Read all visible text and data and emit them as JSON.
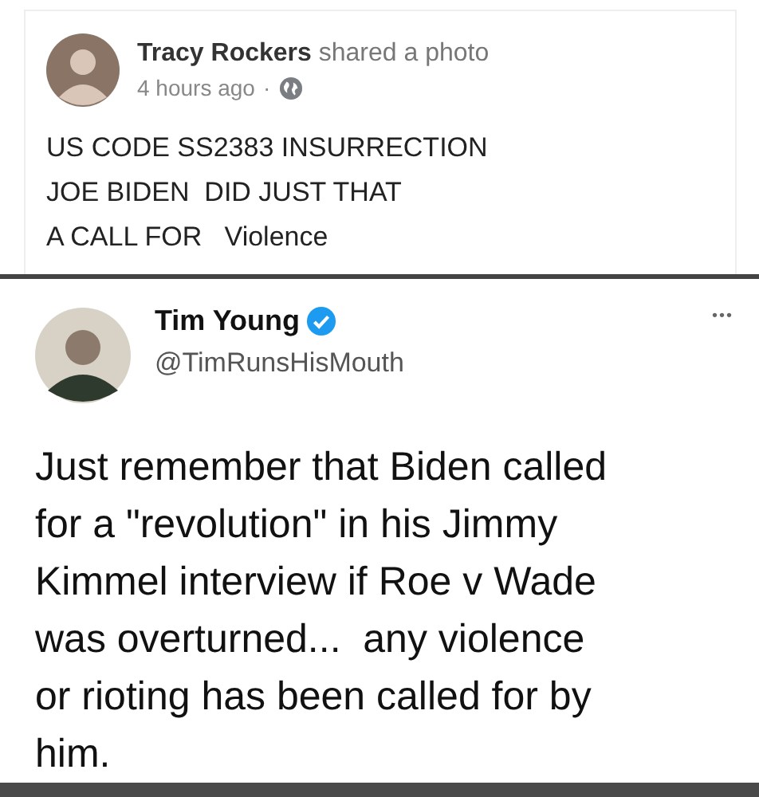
{
  "post": {
    "author": "Tracy Rockers",
    "action": "shared a photo",
    "time": "4 hours ago",
    "separator": "·",
    "lines": [
      "US CODE SS2383 INSURRECTION",
      "JOE BIDEN  DID JUST THAT",
      "A CALL FOR   Violence"
    ]
  },
  "tweet": {
    "name": "Tim Young",
    "verified": true,
    "handle": "@TimRunsHisMouth",
    "more": "•••",
    "lines": [
      "Just remember that Biden called",
      "for a \"revolution\" in his Jimmy",
      "Kimmel interview if Roe v Wade",
      "was overturned...  any violence",
      "or rioting has been called for by",
      "him."
    ]
  }
}
